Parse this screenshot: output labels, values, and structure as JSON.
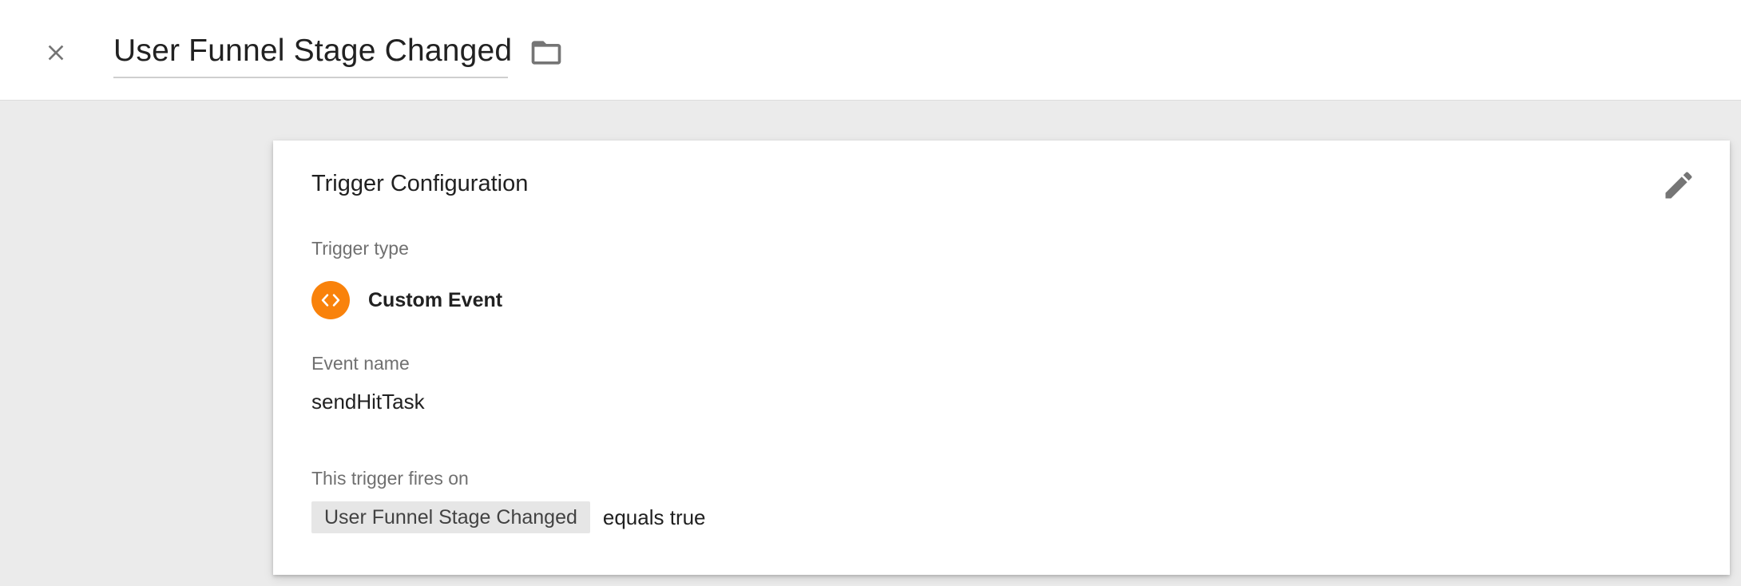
{
  "header": {
    "title": "User Funnel Stage Changed",
    "close_icon": "close-icon",
    "folder_icon": "folder-icon"
  },
  "card": {
    "title": "Trigger Configuration",
    "edit_icon": "pencil-icon",
    "trigger_type": {
      "label": "Trigger type",
      "value": "Custom Event",
      "icon": "code-brackets-icon",
      "icon_color": "#f9820b"
    },
    "event_name": {
      "label": "Event name",
      "value": "sendHitTask"
    },
    "fires_on": {
      "label": "This trigger fires on",
      "variable": "User Funnel Stage Changed",
      "condition": "equals true"
    }
  }
}
